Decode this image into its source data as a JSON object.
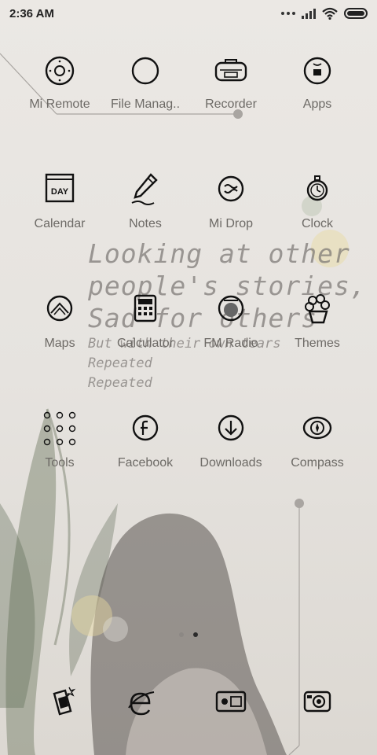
{
  "status_bar": {
    "time": "2:36 AM"
  },
  "apps": [
    {
      "label": "Mi Remote",
      "icon": "remote-icon"
    },
    {
      "label": "File Manag..",
      "icon": "folder-icon"
    },
    {
      "label": "Recorder",
      "icon": "recorder-icon"
    },
    {
      "label": "Apps",
      "icon": "apps-icon"
    },
    {
      "label": "Calendar",
      "icon": "calendar-icon"
    },
    {
      "label": "Notes",
      "icon": "pen-icon"
    },
    {
      "label": "Mi Drop",
      "icon": "mi-drop-icon"
    },
    {
      "label": "Clock",
      "icon": "stopwatch-icon"
    },
    {
      "label": "Maps",
      "icon": "map-icon"
    },
    {
      "label": "Calculator",
      "icon": "calculator-icon"
    },
    {
      "label": "FM Radio",
      "icon": "radio-icon"
    },
    {
      "label": "Themes",
      "icon": "plant-icon"
    },
    {
      "label": "Tools",
      "icon": "tools-grid-icon"
    },
    {
      "label": "Facebook",
      "icon": "facebook-icon"
    },
    {
      "label": "Downloads",
      "icon": "download-icon"
    },
    {
      "label": "Compass",
      "icon": "compass-icon"
    }
  ],
  "calendar_icon_text": "DAY",
  "quote": {
    "line1": "Looking at other",
    "line2": "people's stories,",
    "line3": "Sad for others",
    "line4": "But with their own tears",
    "line5": "Repeated",
    "line6": "Repeated"
  },
  "dock": [
    {
      "icon": "drink-icon"
    },
    {
      "icon": "browser-icon"
    },
    {
      "icon": "gallery-icon"
    },
    {
      "icon": "camera-icon"
    }
  ],
  "page_indicator": {
    "pages": 2,
    "current": 2
  },
  "colors": {
    "label": "#6d6a66",
    "icon_stroke": "#111111",
    "background": "#e8e5e1"
  }
}
